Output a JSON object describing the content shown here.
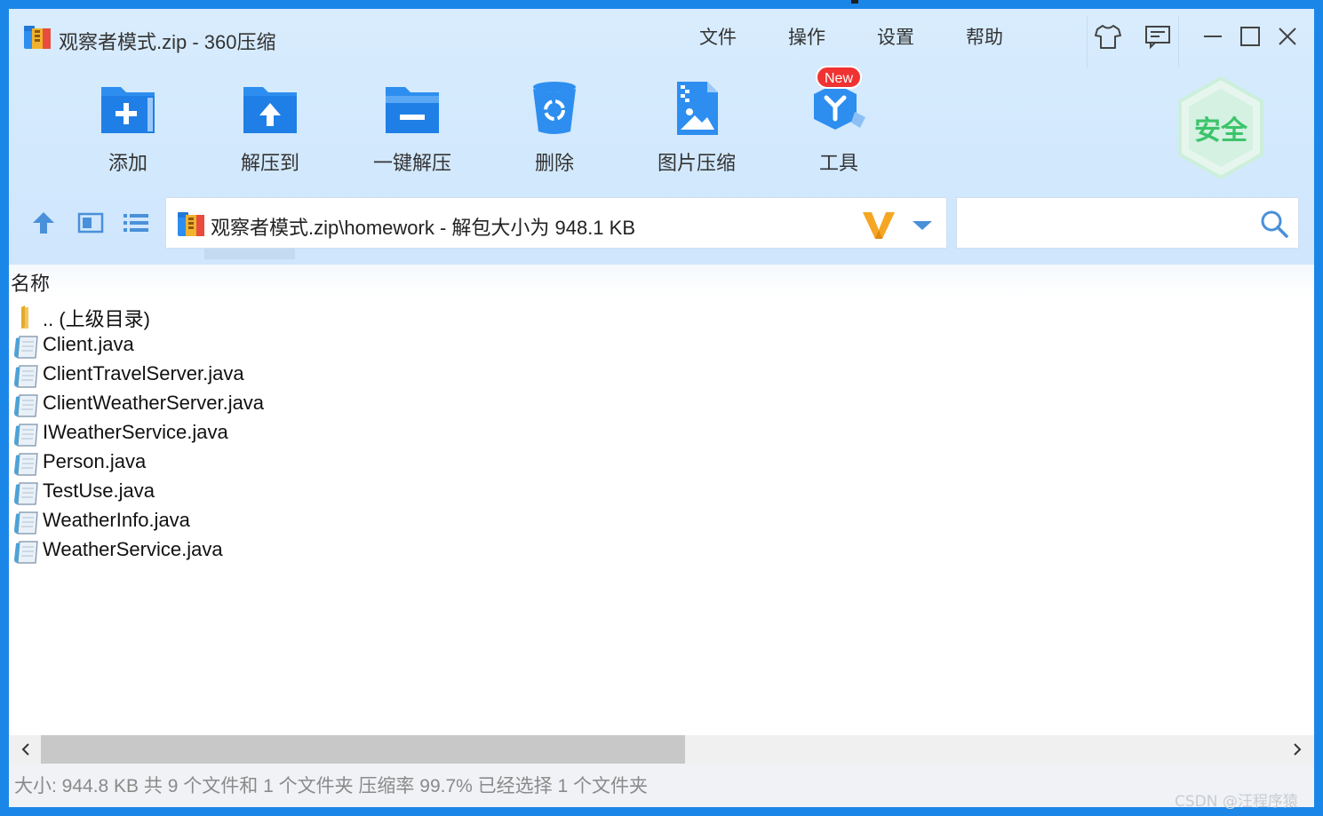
{
  "window": {
    "title": "观察者模式.zip - 360压缩"
  },
  "menu": {
    "items": [
      "文件",
      "操作",
      "设置",
      "帮助"
    ]
  },
  "title_buttons": [
    "skin-icon",
    "feedback-icon",
    "minimize-icon",
    "maximize-icon",
    "close-icon"
  ],
  "toolbar": {
    "add": "添加",
    "extract_to": "解压到",
    "one_click_extract": "一键解压",
    "delete": "删除",
    "image_compress": "图片压缩",
    "tools": "工具",
    "new_badge": "New"
  },
  "security": {
    "label": "安全",
    "color": "#3cc46a"
  },
  "nav": {
    "path": "观察者模式.zip\\homework - 解包大小为 948.1 KB"
  },
  "search": {
    "value": "",
    "placeholder": ""
  },
  "list": {
    "column_name": "名称",
    "parent": ".. (上级目录)",
    "files": [
      "Client.java",
      "ClientTravelServer.java",
      "ClientWeatherServer.java",
      "IWeatherService.java",
      "Person.java",
      "TestUse.java",
      "WeatherInfo.java",
      "WeatherService.java"
    ]
  },
  "status": {
    "text": "大小: 944.8 KB 共 9 个文件和 1 个文件夹 压缩率 99.7% 已经选择 1 个文件夹"
  },
  "watermark": "CSDN @汪程序猿",
  "colors": {
    "accent": "#1a86e8",
    "toolbar_bg": "#d2e8fd",
    "icon_blue": "#2d8ef0",
    "badge_red": "#f03232"
  }
}
